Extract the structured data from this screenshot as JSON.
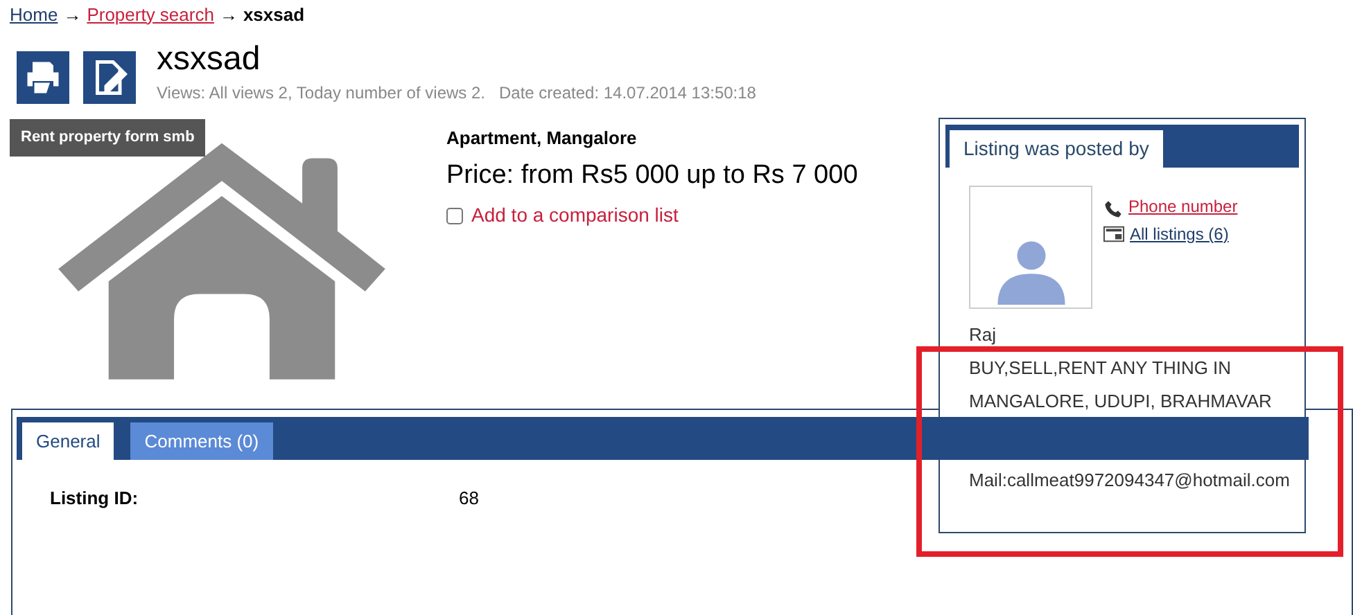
{
  "breadcrumb": [
    {
      "label": "Home",
      "kind": "link"
    },
    {
      "label": "Property search",
      "kind": "accent"
    },
    {
      "label": "xsxsad",
      "kind": "current"
    }
  ],
  "separator": "→",
  "listing": {
    "title": "xsxsad",
    "views": "Views: All views 2, Today number of views 2.",
    "date_created": "Date created: 14.07.2014 13:50:18",
    "image_label": "Rent property form smb",
    "type_location": "Apartment, Mangalore",
    "price": "Price: from Rs5 000 up to Rs 7 000",
    "compare": {
      "label": "Add to a comparison list",
      "checked": false
    }
  },
  "poster": {
    "heading": "Listing was posted by",
    "phone_link": "Phone number",
    "listings_link": "All listings (6)",
    "name": "Raj",
    "description": "BUY,SELL,RENT ANY THING IN MANGALORE, UDUPI, BRAHMAVAR",
    "mail": "Mail:callmeat9972094347@hotmail.com"
  },
  "tabs": [
    {
      "label": "General",
      "selected": true
    },
    {
      "label": "Comments (0)",
      "selected": false
    }
  ],
  "fields": [
    {
      "label": "Listing ID:",
      "value": "68"
    }
  ],
  "highlight": {
    "shown": true
  }
}
